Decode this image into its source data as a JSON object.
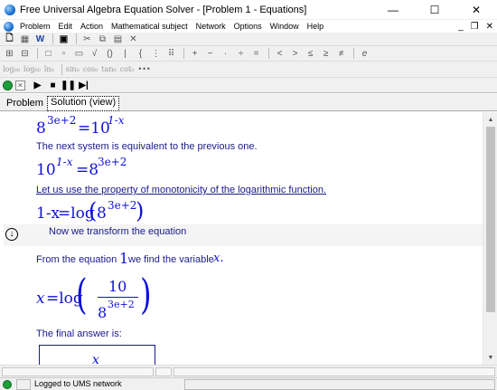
{
  "window": {
    "title": "Free Universal Algebra Equation Solver - [Problem 1 - Equations]",
    "minimize": "—",
    "maximize": "☐",
    "close": "✕"
  },
  "menu": {
    "items": [
      "Problem",
      "Edit",
      "Action",
      "Mathematical subject",
      "Network",
      "Options",
      "Window",
      "Help"
    ],
    "mdi_min": "_",
    "mdi_restore": "❐",
    "mdi_close": "✕"
  },
  "toolbar3": {
    "functions": [
      "log₀₀",
      "log₀₀",
      "ln₀",
      "sin₀",
      "cos₀",
      "tan₀",
      "cot₀",
      "•••"
    ]
  },
  "tabs": {
    "problem": "Problem",
    "solution": "Solution (view)"
  },
  "solution": {
    "eq1": {
      "base": "8",
      "exp": "3e+2",
      "eq": "=10",
      "rexp": "1-x"
    },
    "text1": "The next system is equivalent to the previous one.",
    "eq2": {
      "base": "10",
      "exp": "1-x",
      "eq": "=8",
      "rexp": "3e+2"
    },
    "text2": "Let us use the property of monotonicity of the logarithmic function.",
    "eq3": {
      "lhs": "1-x",
      "eq": "=log",
      "base": "8",
      "exp": "3e+2"
    },
    "step_text": "Now we transform the equation",
    "text3_a": "From  the equation",
    "text3_num": "1",
    "text3_b": "we find the variable",
    "text3_var": "x.",
    "eq4": {
      "lhs": "x",
      "eq": "=log",
      "num": "10",
      "den": "8",
      "den_exp": "3e+2"
    },
    "text4": "The final answer is:",
    "answer": "x"
  },
  "status": {
    "text": "Logged to UMS network"
  }
}
